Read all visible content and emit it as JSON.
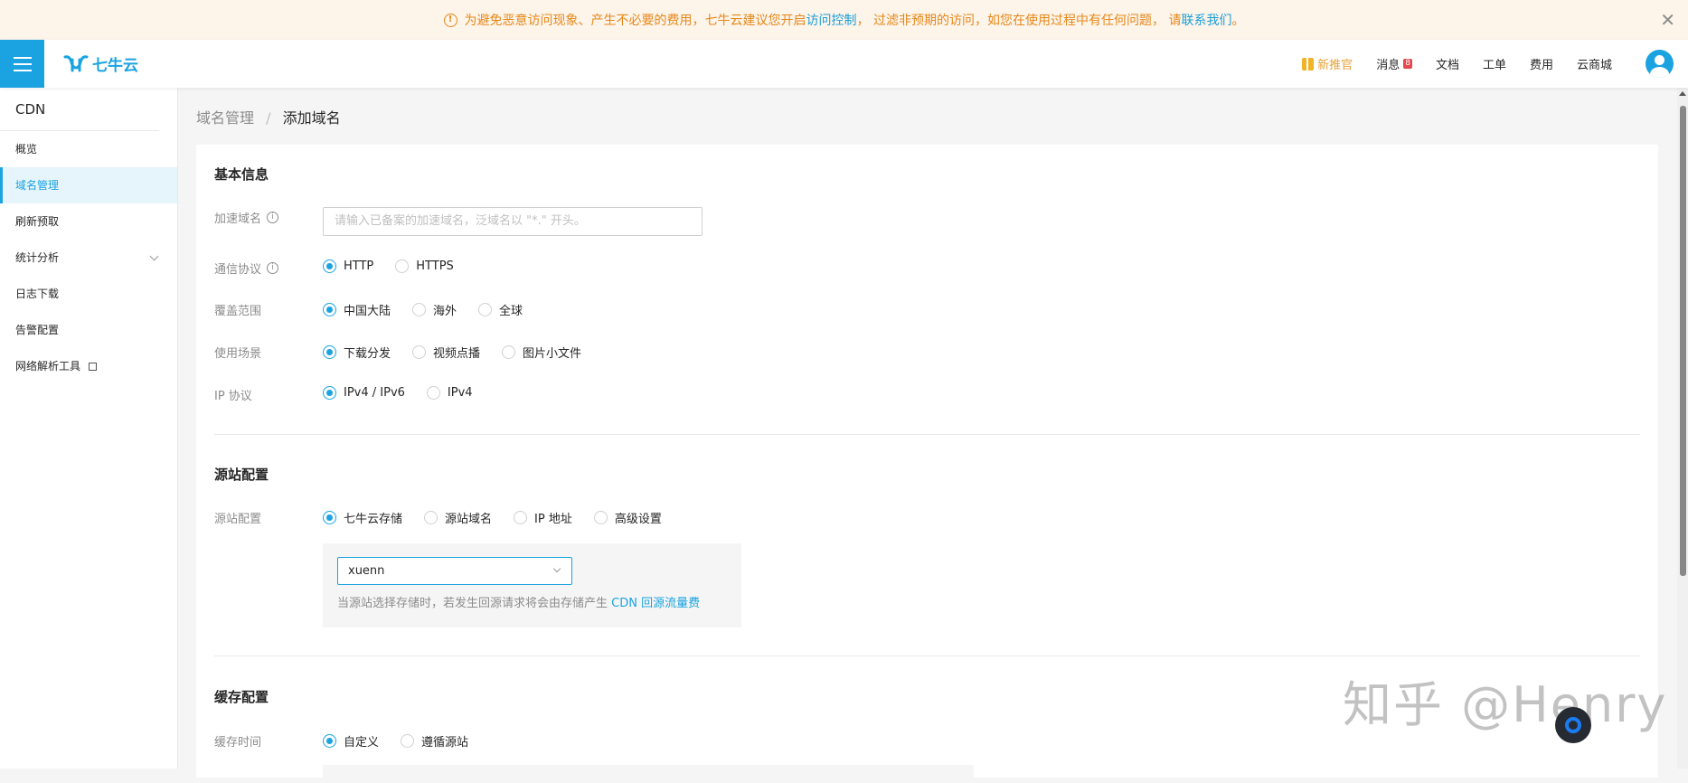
{
  "notice": {
    "text_prefix": "为避免恶意访问现象、产生不必要的费用，七牛云建议您开启",
    "link1": "访问控制",
    "text_mid": "， 过滤非预期的访问，如您在使用过程中有任何问题， 请",
    "link2": "联系我们",
    "text_suffix": "。",
    "close": "✕",
    "warn_icon": "!"
  },
  "header": {
    "logo_text": "七牛云",
    "nav": {
      "recommend": "新推官",
      "messages": "消息",
      "message_count": "8",
      "docs": "文档",
      "tickets": "工单",
      "billing": "费用",
      "market": "云商城"
    }
  },
  "sidebar": {
    "title": "CDN",
    "items": [
      {
        "label": "概览"
      },
      {
        "label": "域名管理"
      },
      {
        "label": "刷新预取"
      },
      {
        "label": "统计分析"
      },
      {
        "label": "日志下载"
      },
      {
        "label": "告警配置"
      },
      {
        "label": "网络解析工具"
      }
    ]
  },
  "breadcrumb": {
    "parent": "域名管理",
    "separator": "/",
    "current": "添加域名"
  },
  "basic": {
    "title": "基本信息",
    "domain_label": "加速域名",
    "domain_placeholder": "请输入已备案的加速域名，泛域名以 \"*.\" 开头。",
    "protocol_label": "通信协议",
    "protocol_options": [
      "HTTP",
      "HTTPS"
    ],
    "coverage_label": "覆盖范围",
    "coverage_options": [
      "中国大陆",
      "海外",
      "全球"
    ],
    "scenario_label": "使用场景",
    "scenario_options": [
      "下载分发",
      "视频点播",
      "图片小文件"
    ],
    "ip_label": "IP 协议",
    "ip_options": [
      "IPv4 / IPv6",
      "IPv4"
    ],
    "info_icon": "i"
  },
  "origin": {
    "title": "源站配置",
    "label": "源站配置",
    "options": [
      "七牛云存储",
      "源站域名",
      "IP 地址",
      "高级设置"
    ],
    "bucket_value": "xuenn",
    "hint_text": "当源站选择存储时，若发生回源请求将会由存储产生 ",
    "hint_link": "CDN 回源流量费"
  },
  "cache": {
    "title": "缓存配置",
    "label": "缓存时间",
    "options": [
      "自定义",
      "遵循源站"
    ]
  },
  "watermark": "知乎 @Henry",
  "colors": {
    "accent": "#1aa3e0",
    "notice_text": "#e6881a",
    "notice_bg": "#fdf4ea"
  }
}
